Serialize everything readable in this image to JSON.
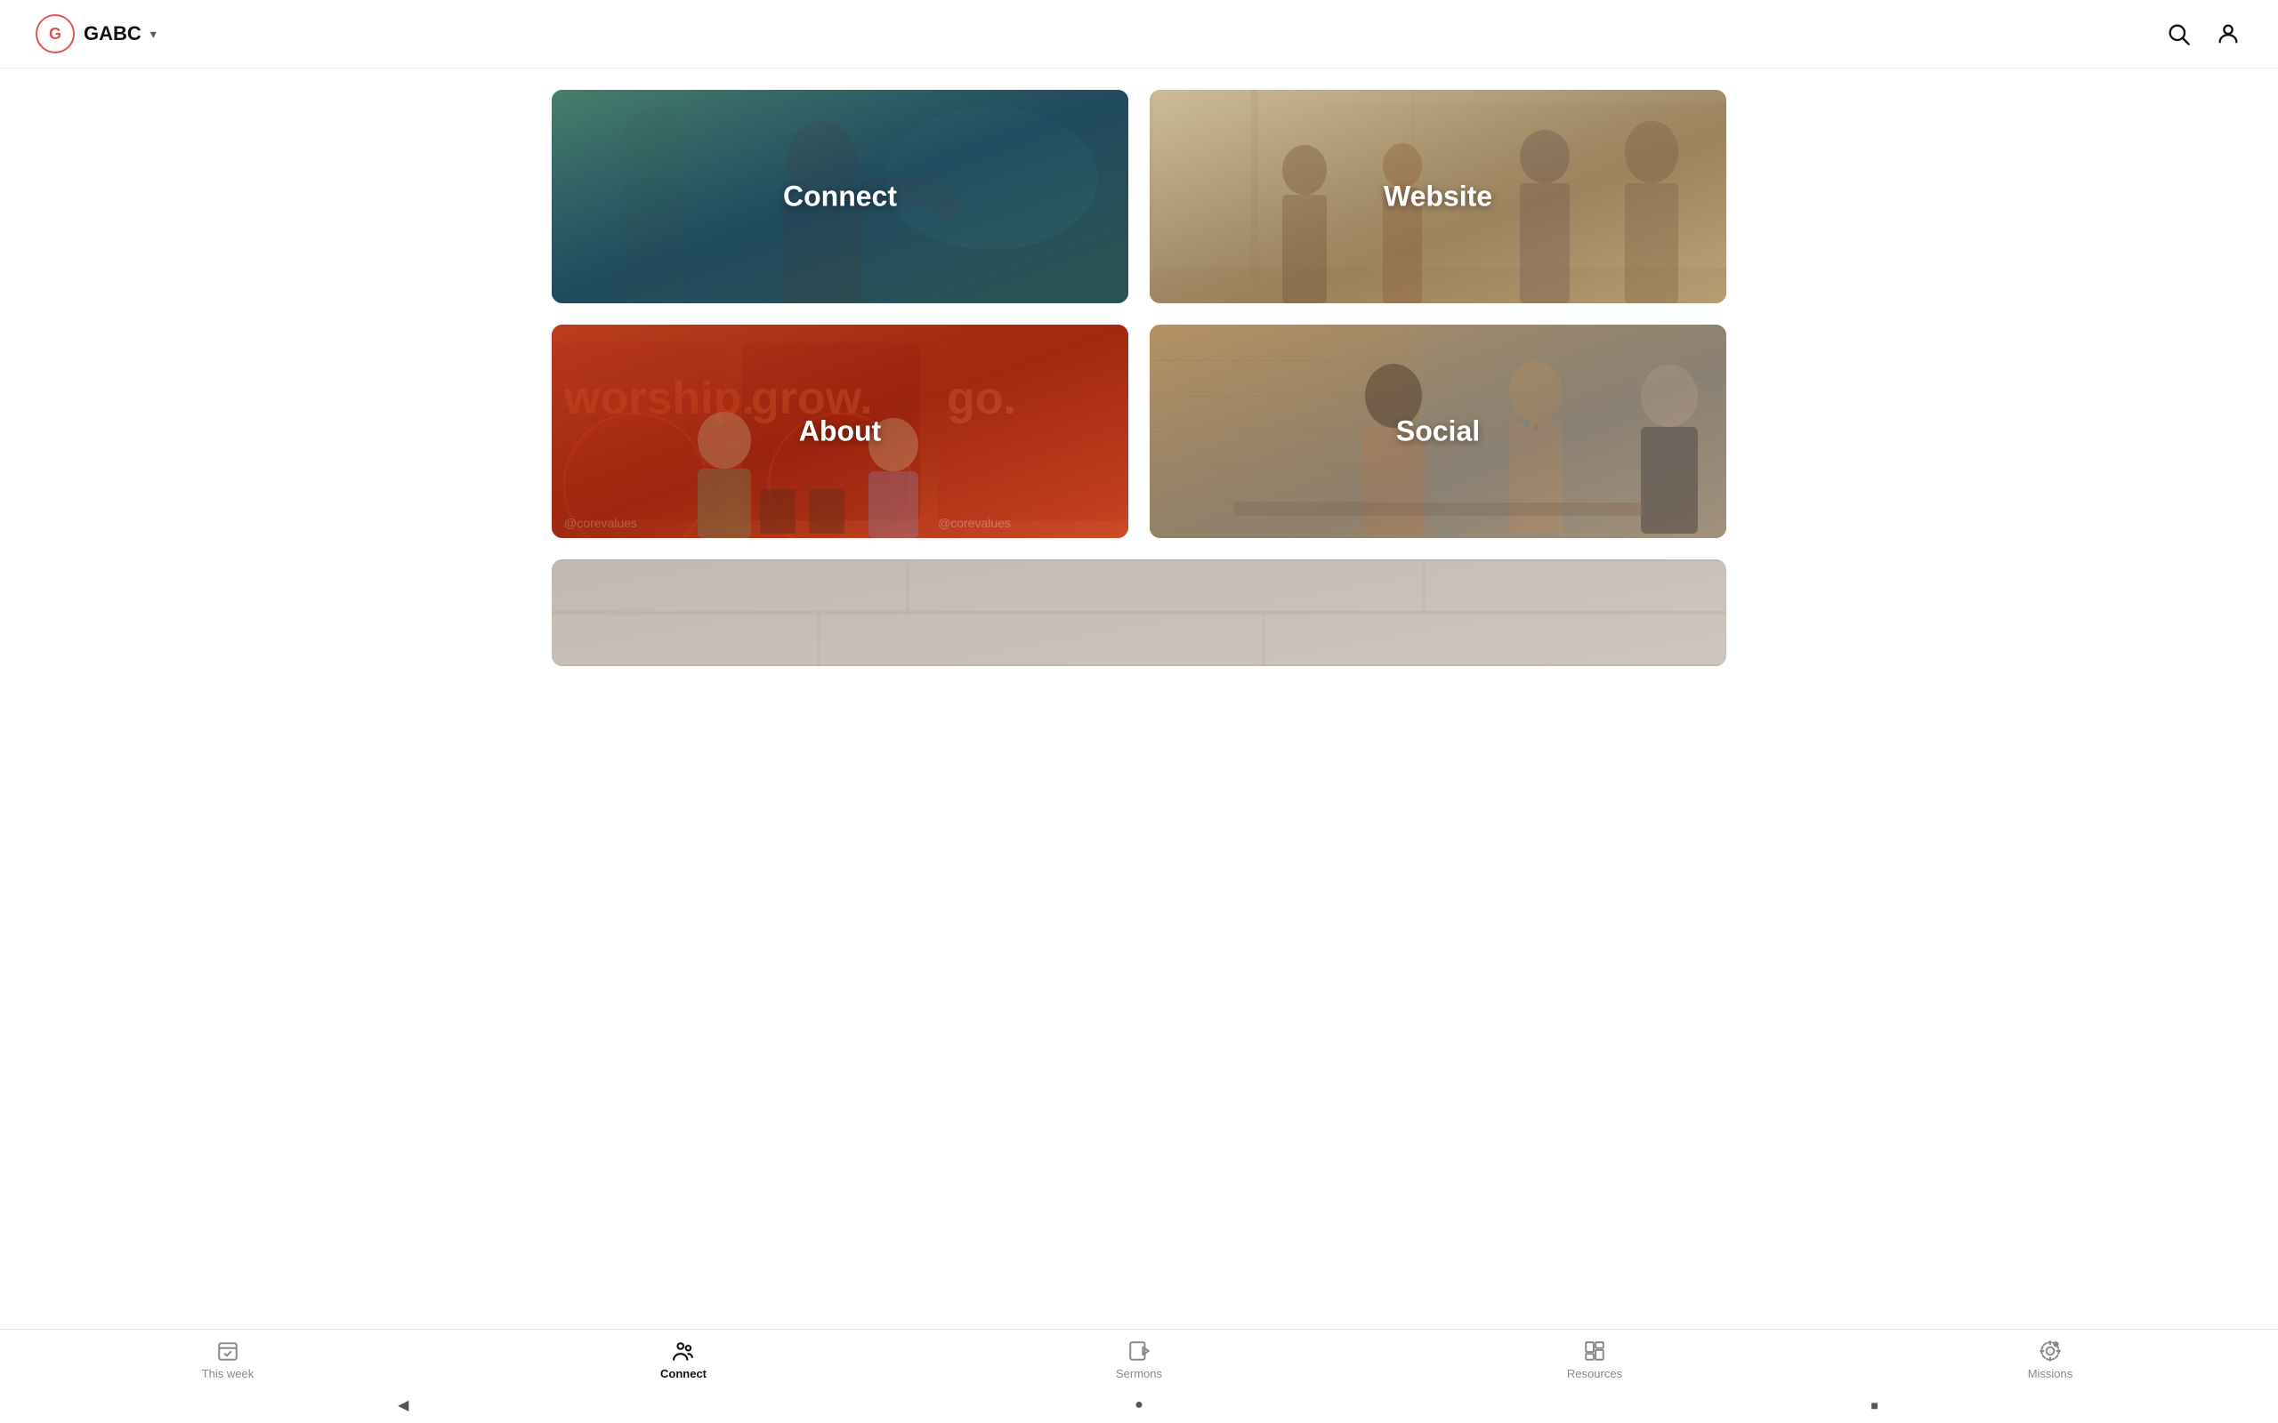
{
  "header": {
    "logo_letter": "G",
    "app_name": "GABC",
    "chevron": "▾"
  },
  "cards": [
    {
      "id": "connect",
      "label": "Connect",
      "type": "connect"
    },
    {
      "id": "website",
      "label": "Website",
      "type": "website"
    },
    {
      "id": "about",
      "label": "About",
      "type": "about"
    },
    {
      "id": "social",
      "label": "Social",
      "type": "social"
    }
  ],
  "bottom_nav": {
    "items": [
      {
        "id": "this-week",
        "label": "This week",
        "active": false
      },
      {
        "id": "connect",
        "label": "Connect",
        "active": true
      },
      {
        "id": "sermons",
        "label": "Sermons",
        "active": false
      },
      {
        "id": "resources",
        "label": "Resources",
        "active": false
      },
      {
        "id": "missions",
        "label": "Missions",
        "active": false
      }
    ]
  },
  "system_bar": {
    "back_label": "◀",
    "home_label": "●",
    "recents_label": "■"
  },
  "colors": {
    "active_nav": "#111111",
    "inactive_nav": "#888888",
    "accent_red": "#e05555"
  }
}
